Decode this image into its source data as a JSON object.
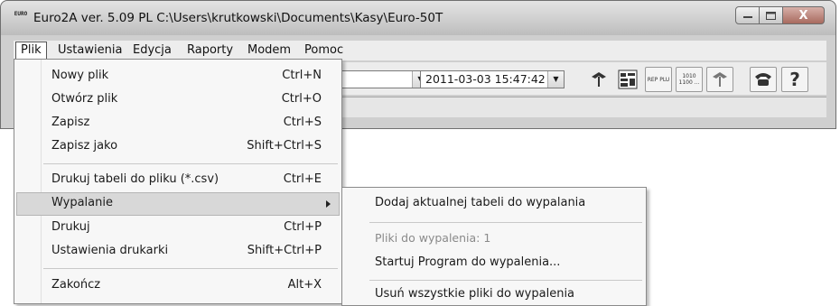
{
  "window": {
    "app_icon_text": "EURO",
    "title": "Euro2A ver. 5.09 PL   C:\\Users\\krutkowski\\Documents\\Kasy\\Euro-50T",
    "close_glyph": "X"
  },
  "menubar": {
    "items": [
      "Plik",
      "Ustawienia",
      "Edycja",
      "Raporty",
      "Modem",
      "Pomoc"
    ]
  },
  "toolbar": {
    "datetime": "2011-03-03 15:47:42",
    "help_label": "?",
    "icons": [
      "tool-icon",
      "pcx-icon",
      "rep-plu-icon",
      "code-icon",
      "tool-2-icon",
      "phone-icon",
      "help-icon"
    ],
    "rep_plu_text": "REP PLU",
    "code_text": "1010 1100 ..."
  },
  "menu": {
    "items": [
      {
        "label": "Nowy plik",
        "shortcut": "Ctrl+N"
      },
      {
        "label": "Otwórz plik",
        "shortcut": "Ctrl+O"
      },
      {
        "label": "Zapisz",
        "shortcut": "Ctrl+S"
      },
      {
        "label": "Zapisz jako",
        "shortcut": "Shift+Ctrl+S"
      },
      {
        "label": "Drukuj tabeli do pliku (*.csv)",
        "shortcut": "Ctrl+E"
      },
      {
        "label": "Wypalanie",
        "shortcut": ""
      },
      {
        "label": "Drukuj",
        "shortcut": "Ctrl+P"
      },
      {
        "label": "Ustawienia drukarki",
        "shortcut": "Shift+Ctrl+P"
      },
      {
        "label": "Zakończ",
        "shortcut": "Alt+X"
      }
    ]
  },
  "submenu": {
    "add": "Dodaj aktualnej tabeli do wypalania",
    "files_info": "Pliki do wypalenia: 1",
    "start": "Startuj Program do wypalenia...",
    "remove_all": "Usuń wszystkie pliki do wypalenia"
  }
}
